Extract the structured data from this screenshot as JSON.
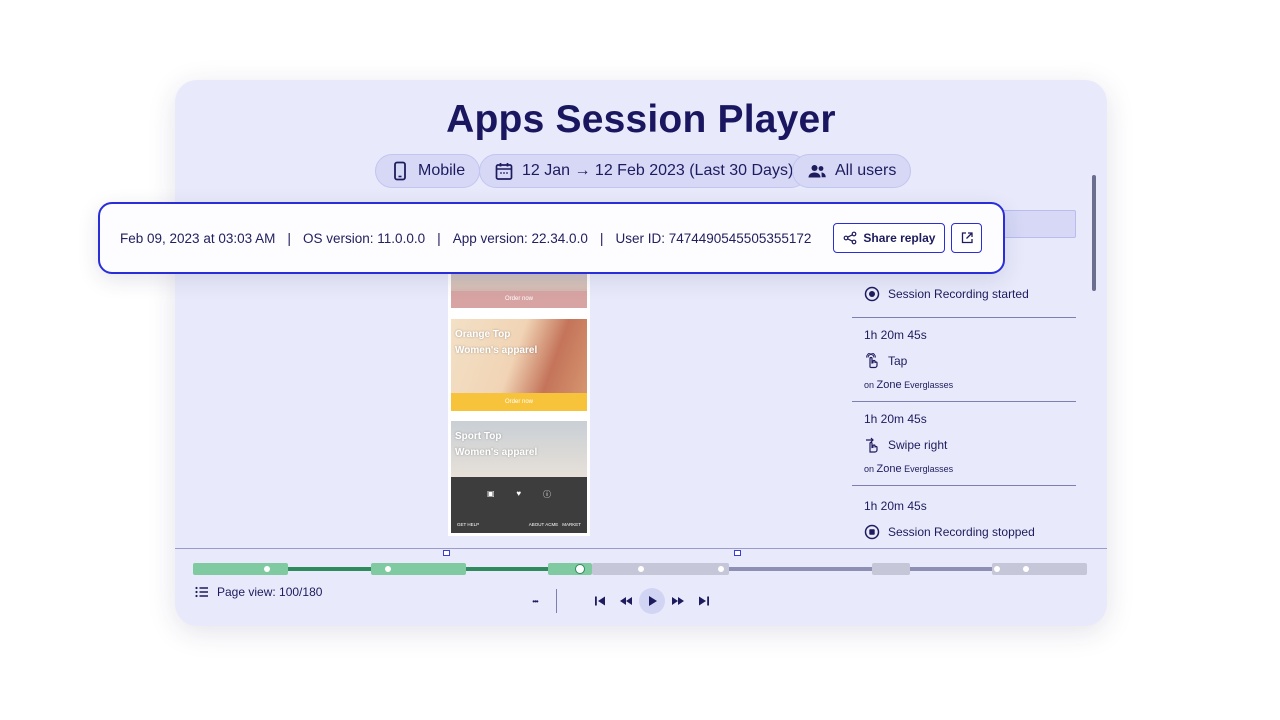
{
  "page": {
    "title": "Apps Session Player"
  },
  "filters": {
    "device": "Mobile",
    "date_range": "12 Jan → 12 Feb 2023 (Last 30 Days)",
    "segment": "All users"
  },
  "session_info": {
    "datetime": "Feb 09, 2023 at 03:03 AM",
    "os_version": "OS version: 11.0.0.0",
    "app_version": "App version: 22.34.0.0",
    "user_id": "User ID: 7474490545505355172",
    "separator": "|",
    "share_label": "Share replay"
  },
  "phone": {
    "tiles": [
      {
        "button": "Order now"
      },
      {
        "title_line1": "Orange Top",
        "title_line2": "Women's apparel",
        "button": "Order now"
      },
      {
        "title_line1": "Sport Top",
        "title_line2": "Women's apparel"
      }
    ],
    "footer_links": [
      "GET HELP",
      "ABOUT ACME",
      "MARKET"
    ]
  },
  "events": [
    {
      "label": "Session Recording started",
      "icon": "record-icon"
    },
    {
      "time": "1h 20m 45s",
      "label": "Tap",
      "icon": "tap-icon",
      "on": "on",
      "zone_word": "Zone",
      "zone_name": "Everglasses"
    },
    {
      "time": "1h 20m 45s",
      "label": "Swipe right",
      "icon": "swipe-icon",
      "on": "on",
      "zone_word": "Zone",
      "zone_name": "Everglasses"
    },
    {
      "time": "1h 20m 45s",
      "label": "Session Recording stopped",
      "icon": "stop-icon"
    }
  ],
  "player": {
    "page_view": "Page view: 100/180",
    "more": "•••"
  },
  "colors": {
    "accent": "#2a2ed8",
    "timeline_green": "#7fcaa0",
    "timeline_green_dark": "#2f8b5e",
    "timeline_gray": "#c5c6d8",
    "timeline_purple": "#8e8fb4"
  }
}
